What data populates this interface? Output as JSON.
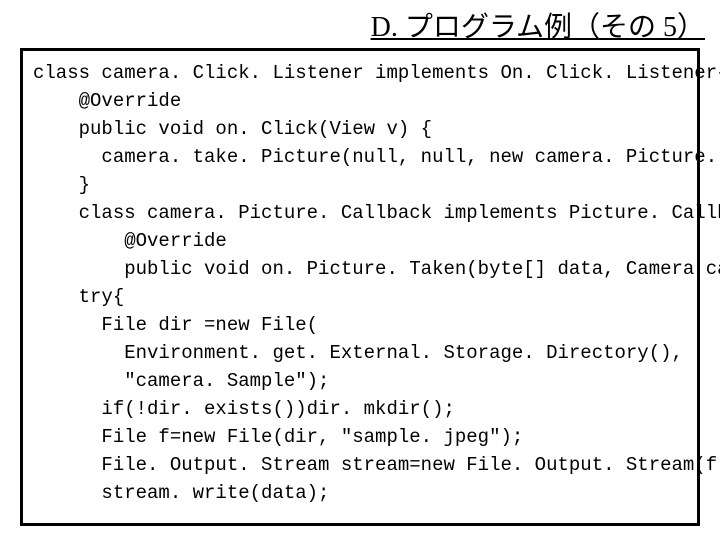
{
  "title": "D. プログラム例（その 5）",
  "code": {
    "l0": "class camera. Click. Listener implements On. Click. Listener{",
    "l1": "    @Override",
    "l2": "    public void on. Click(View v) {",
    "l3": "      camera. take. Picture(null, null, new camera. Picture. Callback());",
    "l4": "    }",
    "l5": "    class camera. Picture. Callback implements Picture. Callback{",
    "l6": "        @Override",
    "l7": "        public void on. Picture. Taken(byte[] data, Camera camera) {",
    "l8": "    try{",
    "l9": "      File dir =new File(",
    "l10": "        Environment. get. External. Storage. Directory(),",
    "l11": "        \"camera. Sample\");",
    "l12": "      if(!dir. exists())dir. mkdir();",
    "l13": "      File f=new File(dir, \"sample. jpeg\");",
    "l14": "      File. Output. Stream stream=new File. Output. Stream(f);",
    "l15": "      stream. write(data);"
  }
}
